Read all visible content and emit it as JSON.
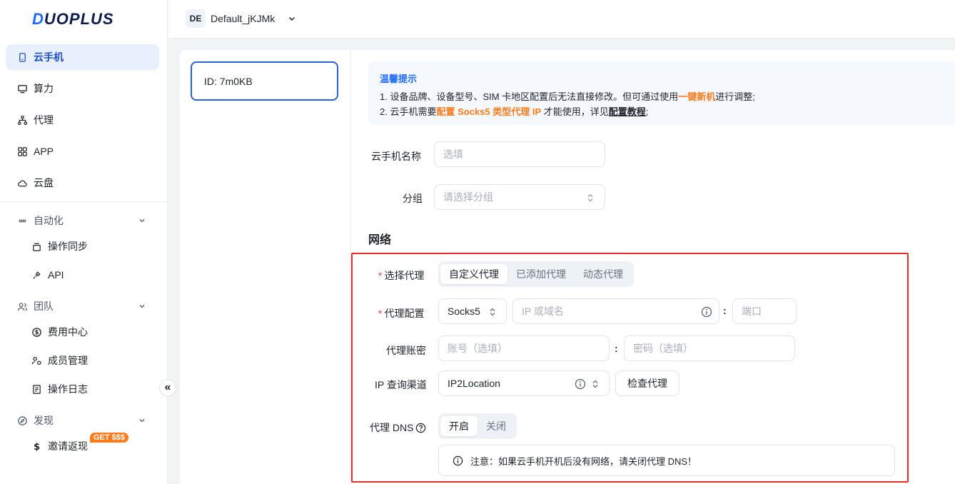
{
  "brand": {
    "logo_d": "D",
    "logo_rest": "UOPLUS"
  },
  "header": {
    "workspace_avatar": "DE",
    "workspace_name": "Default_jKJMk"
  },
  "sidebar": {
    "items": [
      {
        "label": "云手机",
        "icon": "phone-icon"
      },
      {
        "label": "算力",
        "icon": "monitor-icon"
      },
      {
        "label": "代理",
        "icon": "network-icon"
      },
      {
        "label": "APP",
        "icon": "grid-icon"
      },
      {
        "label": "云盘",
        "icon": "cloud-icon"
      }
    ],
    "automation": {
      "title": "自动化",
      "items": [
        "操作同步",
        "API"
      ]
    },
    "team": {
      "title": "团队",
      "items": [
        "费用中心",
        "成员管理",
        "操作日志"
      ]
    },
    "discover": {
      "title": "发现",
      "items": [
        "邀请返现"
      ],
      "badge": "GET $$$"
    }
  },
  "device": {
    "id_label": "ID: 7m0KB"
  },
  "tips": {
    "title": "温馨提示",
    "line1_a": "1. 设备品牌、设备型号、SIM 卡地区配置后无法直接修改。但可通过使用",
    "line1_link": "一键新机",
    "line1_b": "进行调整;",
    "line2_a": "2. 云手机需要",
    "line2_link": "配置 Socks5 类型代理 IP",
    "line2_b": " 才能使用，详见",
    "line2_link2": "配置教程",
    "line2_c": ";"
  },
  "form": {
    "name_label": "云手机名称",
    "name_placeholder": "选填",
    "group_label": "分组",
    "group_placeholder": "请选择分组",
    "network_title": "网络",
    "proxy_select_label": "选择代理",
    "proxy_tabs": [
      "自定义代理",
      "已添加代理",
      "动态代理"
    ],
    "proxy_config_label": "代理配置",
    "proxy_type": "Socks5",
    "host_placeholder": "IP 或域名",
    "port_placeholder": "端口",
    "account_label": "代理账密",
    "account_placeholder": "账号（选填）",
    "password_placeholder": "密码（选填）",
    "ip_channel_label": "IP 查询渠道",
    "ip_channel_value": "IP2Location",
    "check_button": "检查代理",
    "dns_label": "代理 DNS",
    "dns_options": [
      "开启",
      "关闭"
    ],
    "dns_note": "注意：如果云手机开机后没有网络，请关闭代理 DNS！"
  },
  "colors": {
    "accent": "#1e6bff",
    "highlight_border": "#ee2a2a",
    "orange": "#ff7a1a"
  }
}
